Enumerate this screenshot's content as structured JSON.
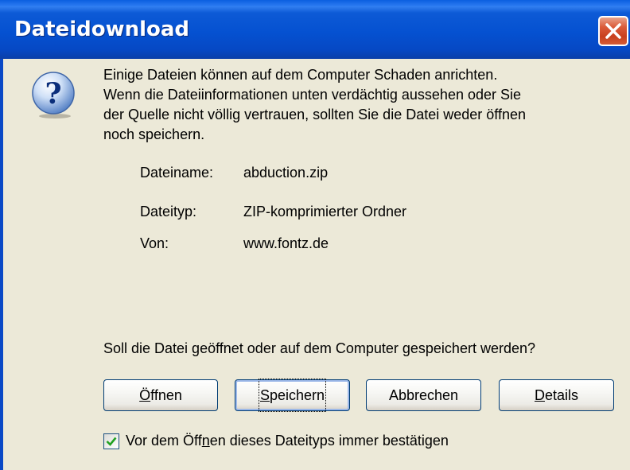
{
  "window": {
    "title": "Dateidownload",
    "close_glyph": "close-icon"
  },
  "warning": {
    "icon": "question-icon",
    "lines": [
      "Einige Dateien können auf dem Computer Schaden anrichten.",
      "Wenn die Dateiinformationen unten verdächtig aussehen oder Sie",
      "der Quelle nicht völlig vertrauen, sollten Sie die Datei weder öffnen",
      "noch speichern."
    ]
  },
  "file_info": {
    "name_label": "Dateiname:",
    "name_value": "abduction.zip",
    "type_label": "Dateityp:",
    "type_value": "ZIP-komprimierter Ordner",
    "from_label": "Von:",
    "from_value": "www.fontz.de"
  },
  "prompt": "Soll die Datei geöffnet oder auf dem Computer gespeichert werden?",
  "buttons": {
    "open": {
      "accel": "Ö",
      "rest": "ffnen"
    },
    "save": {
      "accel": "S",
      "rest": "peichern"
    },
    "cancel": {
      "label": "Abbrechen"
    },
    "details": {
      "accel": "D",
      "rest": "etails"
    }
  },
  "always_confirm": {
    "checked": true,
    "label_pre": "Vor dem Öff",
    "label_accel": "n",
    "label_post": "en dieses Dateityps immer bestätigen"
  },
  "colors": {
    "titlebar": "#0551D1",
    "dialog_bg": "#ECE9D8",
    "close_button": "#C8401E",
    "checkmark": "#21A121"
  }
}
